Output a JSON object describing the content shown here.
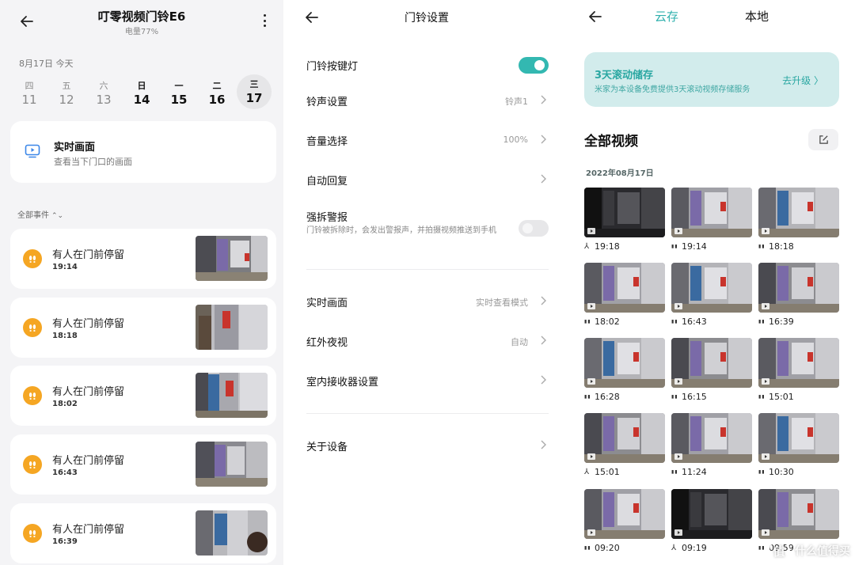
{
  "panel1": {
    "title": "叮零视频门铃E6",
    "battery": "电量77%",
    "date_label": "8月17日 今天",
    "days": [
      {
        "wd": "四",
        "dn": "11"
      },
      {
        "wd": "五",
        "dn": "12"
      },
      {
        "wd": "六",
        "dn": "13"
      },
      {
        "wd": "日",
        "dn": "14"
      },
      {
        "wd": "一",
        "dn": "15"
      },
      {
        "wd": "二",
        "dn": "16"
      },
      {
        "wd": "三",
        "dn": "17"
      }
    ],
    "live_title": "实时画面",
    "live_sub": "查看当下门口的画面",
    "filter_label": "全部事件",
    "events": [
      {
        "title": "有人在门前停留",
        "time": "19:14"
      },
      {
        "title": "有人在门前停留",
        "time": "18:18"
      },
      {
        "title": "有人在门前停留",
        "time": "18:02"
      },
      {
        "title": "有人在门前停留",
        "time": "16:43"
      },
      {
        "title": "有人在门前停留",
        "time": "16:39"
      }
    ]
  },
  "panel2": {
    "title": "门铃设置",
    "rows": [
      {
        "label": "门铃按键灯",
        "value": ""
      },
      {
        "label": "铃声设置",
        "value": "铃声1"
      },
      {
        "label": "音量选择",
        "value": "100%"
      },
      {
        "label": "自动回复",
        "value": ""
      },
      {
        "label": "强拆警报",
        "value": ""
      },
      {
        "label": "实时画面",
        "value": "实时查看模式"
      },
      {
        "label": "红外夜视",
        "value": "自动"
      },
      {
        "label": "室内接收器设置",
        "value": ""
      },
      {
        "label": "关于设备",
        "value": ""
      }
    ],
    "tamper_desc": "门铃被拆除时，会发出警报声，并拍摄视频推送到手机",
    "toggle_key_light_on": true,
    "toggle_tamper_on": false
  },
  "panel3": {
    "tab_cloud": "云存",
    "tab_local": "本地",
    "banner_title": "3天滚动储存",
    "banner_sub": "米家为本设备免费提供3天滚动视频存储服务",
    "banner_upgrade": "去升级 〉",
    "all_videos": "全部视频",
    "date_group": "2022年08月17日",
    "videos": [
      {
        "time": "19:18",
        "icon": "person-icon"
      },
      {
        "time": "19:14",
        "icon": "footprints-icon"
      },
      {
        "time": "18:18",
        "icon": "footprints-icon"
      },
      {
        "time": "18:02",
        "icon": "footprints-icon"
      },
      {
        "time": "16:43",
        "icon": "footprints-icon"
      },
      {
        "time": "16:39",
        "icon": "footprints-icon"
      },
      {
        "time": "16:28",
        "icon": "footprints-icon"
      },
      {
        "time": "16:15",
        "icon": "footprints-icon"
      },
      {
        "time": "15:01",
        "icon": "footprints-icon"
      },
      {
        "time": "15:01",
        "icon": "person-icon"
      },
      {
        "time": "11:24",
        "icon": "footprints-icon"
      },
      {
        "time": "10:30",
        "icon": "footprints-icon"
      },
      {
        "time": "09:20",
        "icon": "footprints-icon"
      },
      {
        "time": "09:19",
        "icon": "person-icon"
      },
      {
        "time": "09:59",
        "icon": "footprints-icon"
      }
    ],
    "watermark": "什么值得买",
    "watermark_glyph": "值"
  },
  "colors": {
    "accent_teal": "#33b8b1",
    "event_orange": "#f5a623",
    "banner_bg": "#d2ecec"
  }
}
